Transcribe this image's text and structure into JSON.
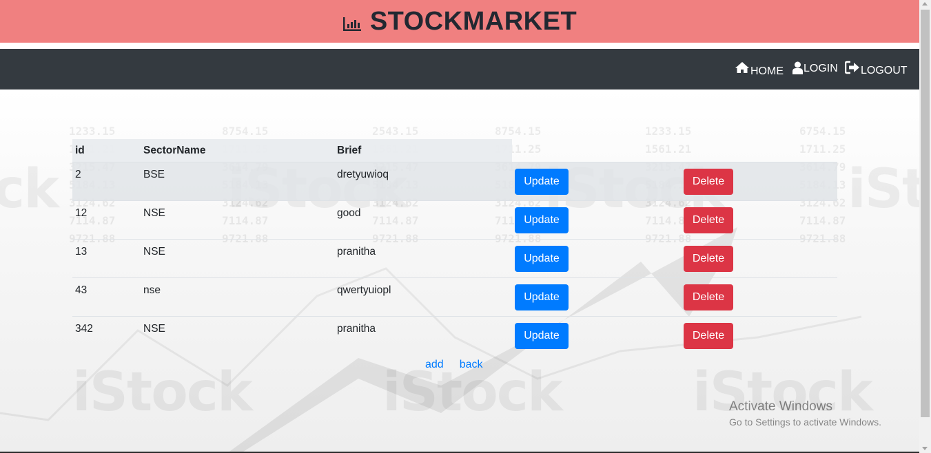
{
  "header": {
    "title": "STOCKMARKET",
    "icon": "bar-chart-icon"
  },
  "nav": {
    "items": [
      {
        "label": "HOME",
        "icon": "home-icon"
      },
      {
        "label": "LOGIN",
        "icon": "user-icon"
      },
      {
        "label": "LOGOUT",
        "icon": "sign-out-icon"
      }
    ]
  },
  "table": {
    "headers": [
      "id",
      "SectorName",
      "Brief"
    ],
    "rows": [
      {
        "id": "2",
        "sector": "BSE",
        "brief": "dretyuwioq"
      },
      {
        "id": "12",
        "sector": "NSE",
        "brief": "good"
      },
      {
        "id": "13",
        "sector": "NSE",
        "brief": "pranitha"
      },
      {
        "id": "43",
        "sector": "nse",
        "brief": "qwertyuiopl"
      },
      {
        "id": "342",
        "sector": "NSE",
        "brief": "pranitha"
      }
    ],
    "update_label": "Update",
    "delete_label": "Delete"
  },
  "links": {
    "add": "add",
    "back": "back"
  },
  "overlay": {
    "activate_title": "Activate Windows",
    "activate_sub": "Go to Settings to activate Windows."
  },
  "colors": {
    "header_bg": "#f08080",
    "nav_bg": "#343a40",
    "update_btn": "#007bff",
    "delete_btn": "#dc3545",
    "link": "#007bff"
  }
}
